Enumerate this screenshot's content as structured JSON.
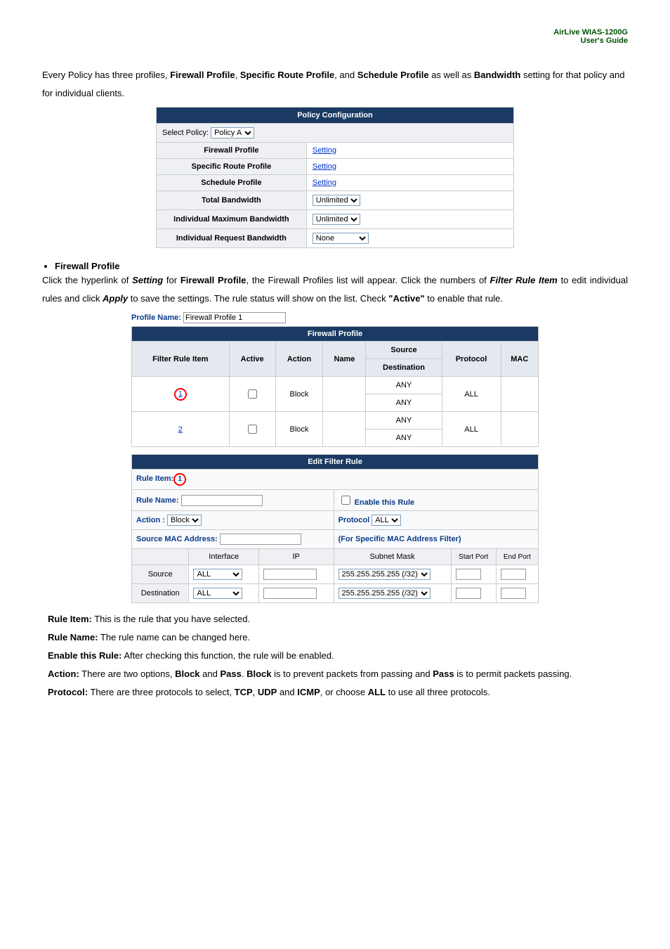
{
  "header": {
    "product": "AirLive WIAS-1200G",
    "doc": "User's Guide"
  },
  "intro": {
    "line1_prefix": "Every Policy has three profiles, ",
    "p1": "Firewall Profile",
    "p2": "Specific Route Profile",
    "line1_and": ", and ",
    "p3": "Schedule Profile",
    "line1_suffix": " as well as",
    "line2_prefix": "",
    "b1": "Bandwidth",
    "line2_suffix": " setting for that policy and for individual clients."
  },
  "policyConfig": {
    "title": "Policy Configuration",
    "selectLabel": "Select Policy:",
    "selectValue": "Policy A",
    "rows": [
      {
        "label": "Firewall Profile",
        "value": "Setting",
        "isLink": true
      },
      {
        "label": "Specific Route Profile",
        "value": "Setting",
        "isLink": true
      },
      {
        "label": "Schedule Profile",
        "value": "Setting",
        "isLink": true
      },
      {
        "label": "Total Bandwidth",
        "value": "Unlimited",
        "isSelect": true
      },
      {
        "label": "Individual Maximum Bandwidth",
        "value": "Unlimited",
        "isSelect": true
      },
      {
        "label": "Individual Request Bandwidth",
        "value": "None",
        "isSelect": true
      }
    ]
  },
  "firewallSection": {
    "bullet": "Firewall Profile",
    "desc_p1": "Click the hyperlink of ",
    "desc_b1": "Setting",
    "desc_p2": " for ",
    "desc_b2": "Firewall Profile",
    "desc_p3": ", the Firewall Profiles list will appear. Click the numbers of ",
    "desc_b3": "Filter Rule Item",
    "desc_p4": " to edit individual rules and click ",
    "desc_b4": "Apply",
    "desc_p5": " to save the settings. The rule status will show on the list. Check ",
    "desc_b5": "\"Active\"",
    "desc_p6": " to enable that rule.",
    "profileNameLabel": "Profile Name:",
    "profileNameValue": "Firewall Profile 1",
    "tableTitle": "Firewall Profile",
    "cols": [
      "Filter Rule Item",
      "Active",
      "Action",
      "Name",
      "Source",
      "Destination",
      "Protocol",
      "MAC"
    ],
    "sdLabel1": "Source",
    "sdLabel2": "Destination",
    "rows": [
      {
        "num": "1",
        "active": false,
        "action": "Block",
        "name": "",
        "src": "ANY",
        "dst": "ANY",
        "proto": "ALL",
        "mac": "",
        "circled": true
      },
      {
        "num": "2",
        "active": false,
        "action": "Block",
        "name": "",
        "src": "ANY",
        "dst": "ANY",
        "proto": "ALL",
        "mac": "",
        "circled": false
      }
    ]
  },
  "editFilter": {
    "title": "Edit Filter Rule",
    "ruleItemLabel": "Rule Item:",
    "ruleItemNum": "1",
    "ruleNameLabel": "Rule Name:",
    "enableLabel": "Enable this Rule",
    "actionLabel": "Action :",
    "actionValue": "Block",
    "protocolLabel": "Protocol",
    "protocolValue": "ALL",
    "macLabel": "Source MAC Address:",
    "macNote": "(For Specific MAC Address Filter)",
    "cols": {
      "iface": "Interface",
      "ip": "IP",
      "mask": "Subnet Mask",
      "start": "Start Port",
      "end": "End Port"
    },
    "rows": [
      {
        "label": "Source",
        "iface": "ALL",
        "mask": "255.255.255.255 (/32)"
      },
      {
        "label": "Destination",
        "iface": "ALL",
        "mask": "255.255.255.255 (/32)"
      }
    ]
  },
  "notes": {
    "n1_b": "Rule Item:",
    "n1_t": " This is the rule that you have selected.",
    "n2_b": "Rule Name:",
    "n2_t": " The rule name can be changed here.",
    "n3_b": "Enable this Rule:",
    "n3_t": " After checking this function, the rule will be enabled.",
    "n4_b": "Action:",
    "n4_t1": " There are two options, ",
    "n4_b2": "Block",
    "n4_t2": " and ",
    "n4_b3": "Pass",
    "n4_t3": ". ",
    "n4_b4": "Block",
    "n4_t4": " is to prevent packets from passing and ",
    "n4_b5": "Pass",
    "n4_t5": " is to permit packets passing.",
    "n5_b": "Protocol:",
    "n5_t1": " There are three protocols to select, ",
    "n5_b2": "TCP",
    "n5_t2": ", ",
    "n5_b3": "UDP",
    "n5_t3": " and ",
    "n5_b4": "ICMP",
    "n5_t4": ", or choose ",
    "n5_b5": "ALL",
    "n5_t5": " to use all three protocols."
  }
}
